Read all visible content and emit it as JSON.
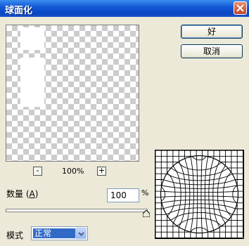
{
  "window": {
    "title": "球面化",
    "close_icon": "close-icon"
  },
  "preview": {
    "zoom_value": "100%",
    "zoom_out_label": "-",
    "zoom_in_label": "+"
  },
  "buttons": {
    "ok": "好",
    "cancel": "取消"
  },
  "amount": {
    "label": "数量",
    "mnemonic": "A",
    "value": "100",
    "unit": "%",
    "level_percent": 100
  },
  "mode": {
    "label": "模式",
    "selected": "正常"
  },
  "colors": {
    "titlebar": "#0a47c4",
    "dialog_bg": "#ece9d8",
    "selection": "#316ac5"
  }
}
